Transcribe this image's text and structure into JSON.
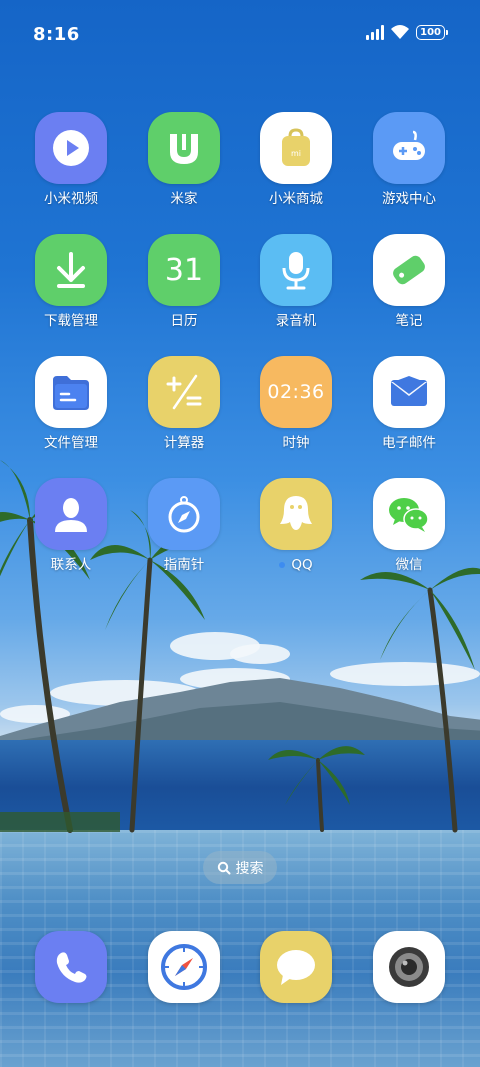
{
  "status_bar": {
    "time": "8:16",
    "battery": "100",
    "icons": [
      "signal-icon",
      "wifi-icon",
      "battery-icon"
    ]
  },
  "apps": [
    {
      "label": "小米视频",
      "icon": "play-icon",
      "color": "#6b7ff2"
    },
    {
      "label": "米家",
      "icon": "mijia-icon",
      "color": "#5fcf6a"
    },
    {
      "label": "小米商城",
      "icon": "shopping-bag-icon",
      "color": "#ffffff"
    },
    {
      "label": "游戏中心",
      "icon": "gamepad-icon",
      "color": "#5b9af5"
    },
    {
      "label": "下载管理",
      "icon": "download-arrow-icon",
      "color": "#5fcf6a"
    },
    {
      "label": "日历",
      "icon": "calendar-icon",
      "value": "31",
      "color": "#5fcf6a"
    },
    {
      "label": "录音机",
      "icon": "microphone-icon",
      "color": "#5bbdf3"
    },
    {
      "label": "笔记",
      "icon": "note-tag-icon",
      "color": "#ffffff"
    },
    {
      "label": "文件管理",
      "icon": "folder-icon",
      "color": "#ffffff"
    },
    {
      "label": "计算器",
      "icon": "calculator-icon",
      "color": "#e8d26a"
    },
    {
      "label": "时钟",
      "icon": "clock-icon",
      "value": "02:36",
      "color": "#f7b960"
    },
    {
      "label": "电子邮件",
      "icon": "envelope-icon",
      "color": "#ffffff"
    },
    {
      "label": "联系人",
      "icon": "person-icon",
      "color": "#6b7ff2"
    },
    {
      "label": "指南针",
      "icon": "compass-icon",
      "color": "#5b9af5"
    },
    {
      "label": "QQ",
      "icon": "qq-penguin-icon",
      "color": "#e8d26a",
      "has_dot": true
    },
    {
      "label": "微信",
      "icon": "wechat-icon",
      "color": "#ffffff"
    }
  ],
  "search": {
    "label": "搜索",
    "icon": "search-icon"
  },
  "dock": [
    {
      "name": "phone",
      "icon": "phone-icon",
      "color": "#6b7ff2"
    },
    {
      "name": "browser",
      "icon": "browser-compass-icon",
      "color": "#ffffff"
    },
    {
      "name": "messages",
      "icon": "message-bubble-icon",
      "color": "#e8d26a"
    },
    {
      "name": "camera",
      "icon": "camera-lens-icon",
      "color": "#ffffff"
    }
  ]
}
